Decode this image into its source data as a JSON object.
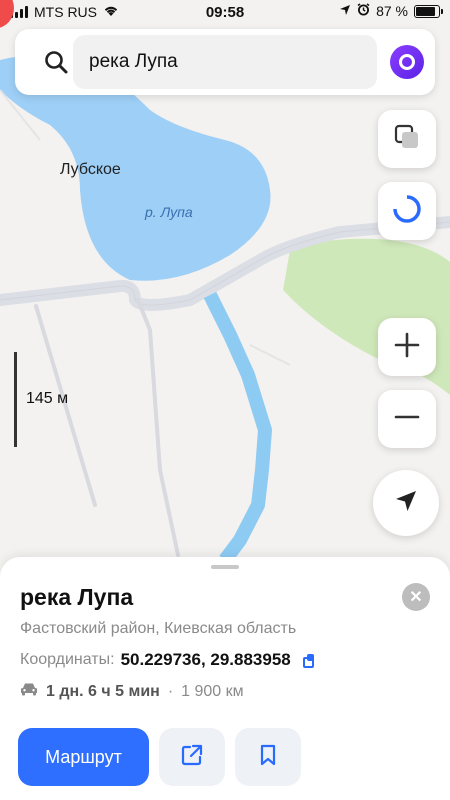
{
  "status_bar": {
    "carrier": "MTS RUS",
    "time": "09:58",
    "battery": "87 %",
    "battery_level": 0.87
  },
  "search": {
    "query": "река Лупа"
  },
  "map": {
    "labels": {
      "village": "Лубское",
      "river": "р. Лупа"
    },
    "scale": "145 м",
    "colors": {
      "water": "#9ecff6",
      "river": "#8ecbf3",
      "park": "#cfe8ba",
      "road": "#dcdee5",
      "background": "#f3f2f0"
    }
  },
  "controls": {
    "layers": "layers-icon",
    "alice": "alice-icon",
    "zoom_in": "+",
    "zoom_out": "−",
    "locate": "navigation-arrow-icon"
  },
  "place_card": {
    "title": "река Лупа",
    "subtitle": "Фастовский район, Киевская область",
    "coords_label": "Координаты:",
    "coords_value": "50.229736, 29.883958",
    "duration": "1 дн. 6 ч 5 мин",
    "separator": "·",
    "distance": "1 900 км",
    "route_button": "Маршрут",
    "accent": "#2f6fff"
  }
}
